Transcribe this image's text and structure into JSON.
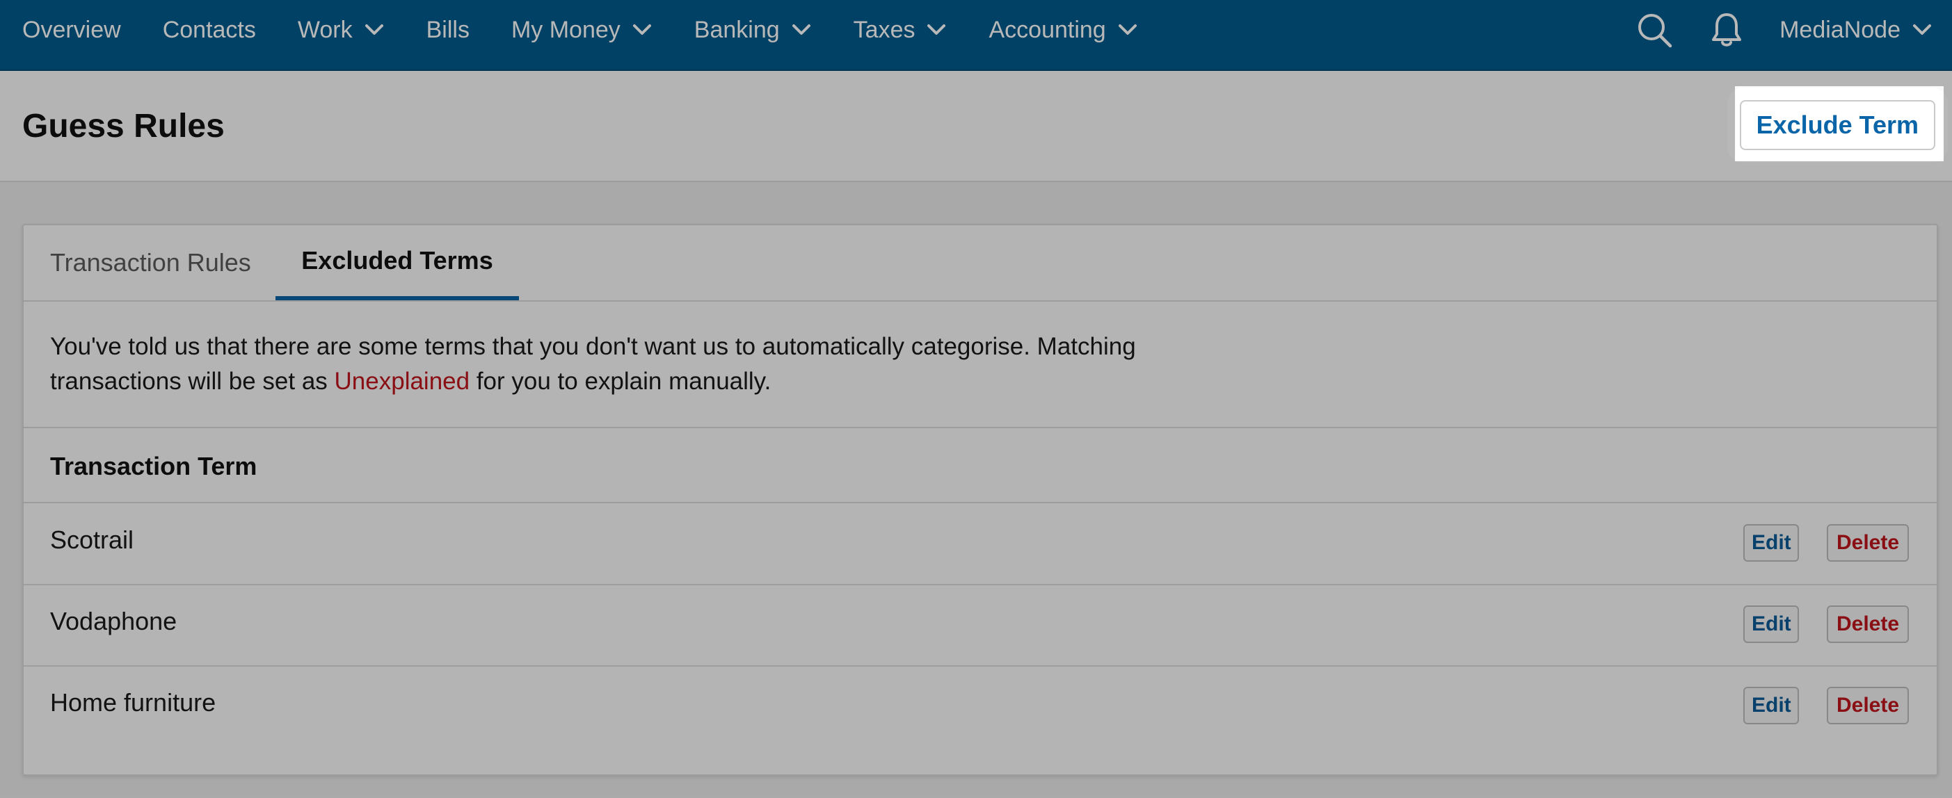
{
  "nav": {
    "items": [
      {
        "label": "Overview",
        "has_dropdown": false
      },
      {
        "label": "Contacts",
        "has_dropdown": false
      },
      {
        "label": "Work",
        "has_dropdown": true
      },
      {
        "label": "Bills",
        "has_dropdown": false
      },
      {
        "label": "My Money",
        "has_dropdown": true
      },
      {
        "label": "Banking",
        "has_dropdown": true
      },
      {
        "label": "Taxes",
        "has_dropdown": true
      },
      {
        "label": "Accounting",
        "has_dropdown": true
      }
    ],
    "search_icon": "search-icon",
    "notifications_icon": "bell-icon",
    "account_name": "MediaNode"
  },
  "header": {
    "title": "Guess Rules",
    "action_label": "Exclude Term"
  },
  "tabs": [
    {
      "label": "Transaction Rules",
      "active": false
    },
    {
      "label": "Excluded Terms",
      "active": true
    }
  ],
  "description": {
    "before": "You've told us that there are some terms that you don't want us to automatically categorise. Matching transactions will be set as ",
    "highlight": "Unexplained",
    "after": " for you to explain manually."
  },
  "table": {
    "header": "Transaction Term",
    "rows": [
      {
        "term": "Scotrail",
        "edit_label": "Edit",
        "delete_label": "Delete"
      },
      {
        "term": "Vodaphone",
        "edit_label": "Edit",
        "delete_label": "Delete"
      },
      {
        "term": "Home furniture",
        "edit_label": "Edit",
        "delete_label": "Delete"
      }
    ]
  },
  "colors": {
    "nav_background": "#005a8c",
    "accent_blue": "#0a65a8",
    "danger_red": "#c0161c"
  }
}
